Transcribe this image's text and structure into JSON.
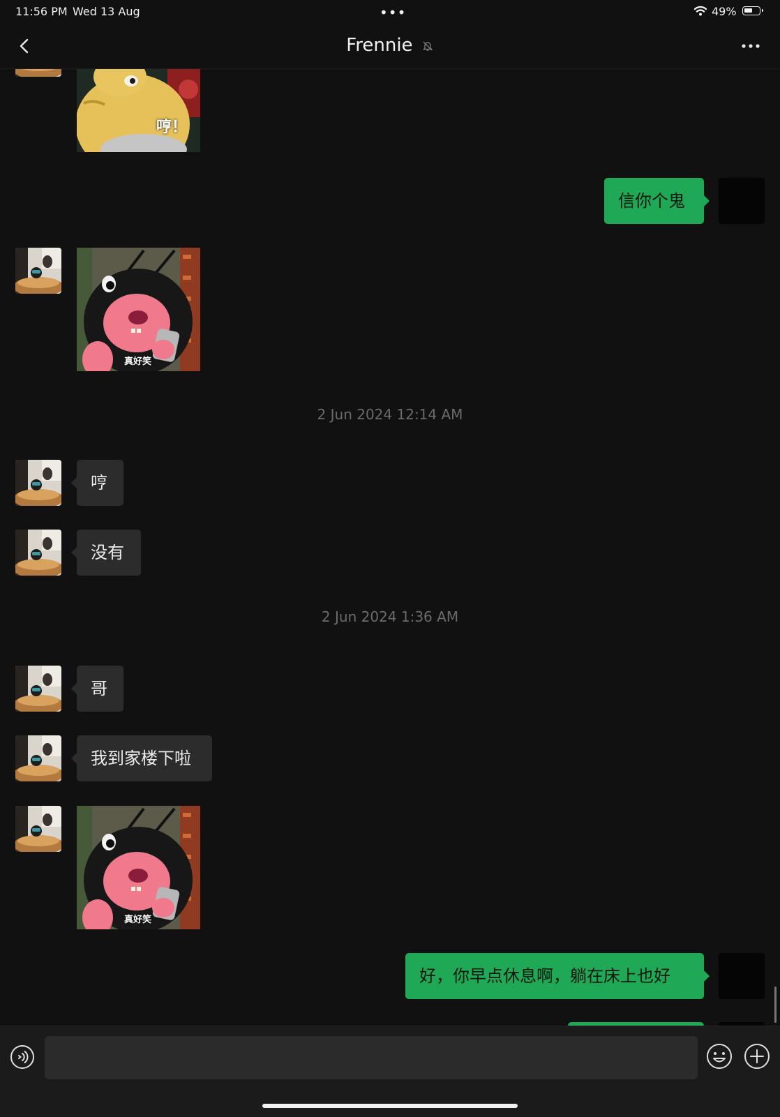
{
  "status_bar": {
    "time": "11:56 PM",
    "date": "Wed 13 Aug",
    "battery_text": "49%",
    "battery_level": 0.49,
    "icons": [
      "wifi-icon",
      "battery-icon"
    ]
  },
  "nav": {
    "title": "Frennie",
    "icons": [
      "back-chevron-icon",
      "mute-bell-icon",
      "more-options-icon"
    ]
  },
  "messages": [
    {
      "side": "left",
      "type": "sticker",
      "sticker": "yellow-character",
      "caption": "哼！"
    },
    {
      "side": "right",
      "type": "text",
      "text": "信你个鬼"
    },
    {
      "side": "left",
      "type": "sticker",
      "sticker": "pink-mole-phone",
      "caption": "真好笑"
    },
    {
      "type": "timestamp",
      "text": "2 Jun 2024 12:14 AM"
    },
    {
      "side": "left",
      "type": "text",
      "text": "哼"
    },
    {
      "side": "left",
      "type": "text",
      "text": "没有"
    },
    {
      "type": "timestamp",
      "text": "2 Jun 2024 1:36 AM"
    },
    {
      "side": "left",
      "type": "text",
      "text": "哥"
    },
    {
      "side": "left",
      "type": "text",
      "text": "我到家楼下啦"
    },
    {
      "side": "left",
      "type": "sticker",
      "sticker": "pink-mole-phone",
      "caption": "真好笑"
    },
    {
      "side": "right",
      "type": "text",
      "text": "好，你早点休息啊，躺在床上也好"
    }
  ],
  "input": {
    "value": "",
    "icons": [
      "voice-icon",
      "emoji-icon",
      "plus-icon"
    ]
  },
  "colors": {
    "background": "#111111",
    "incoming_bubble": "#2c2c2c",
    "outgoing_bubble": "#1fa855",
    "timestamp": "#6b6b6b"
  }
}
